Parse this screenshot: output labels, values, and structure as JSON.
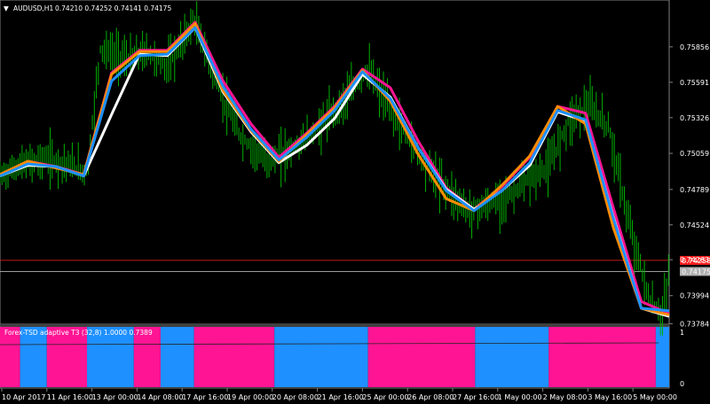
{
  "window_title": "AUDUSD,H1",
  "ohlc_text": "0.74210 0.74252 0.74141 0.74175",
  "main_chart": {
    "type": "line",
    "y_range": [
      0.7378,
      0.7618
    ],
    "y_ticks": [
      "0.75856",
      "0.75591",
      "0.75326",
      "0.75059",
      "0.74789",
      "0.74524",
      "0.74263",
      "0.73994",
      "0.73784"
    ],
    "y_tick_values": [
      0.75856,
      0.75591,
      0.75326,
      0.75059,
      0.74789,
      0.74524,
      0.74263,
      0.73994,
      0.73784
    ],
    "x_labels": [
      "10 Apr 2017",
      "11 Apr 16:00",
      "13 Apr 00:00",
      "14 Apr 08:00",
      "17 Apr 16:00",
      "19 Apr 00:00",
      "20 Apr 08:00",
      "21 Apr 16:00",
      "25 Apr 00:00",
      "26 Apr 08:00",
      "27 Apr 16:00",
      "1 May 00:00",
      "2 May 08:00",
      "3 May 16:00",
      "5 May 00:00"
    ],
    "horizontal_lines": [
      {
        "label": "0.74258",
        "value": 0.74258,
        "color": "#ff2020"
      },
      {
        "label": "0.74175",
        "value": 0.74175,
        "color": "#b0b0b0"
      }
    ],
    "colors": {
      "price": "#00b000",
      "white_ma": "#ffffff",
      "blue_ma": "#1e90ff",
      "orange_ma": "#ff8c00",
      "pink_ma": "#ff1493"
    },
    "x_index": [
      0,
      5,
      10,
      15,
      20,
      25,
      30,
      35,
      40,
      45,
      50,
      55,
      60,
      65,
      70,
      75,
      80,
      85,
      90,
      95,
      100
    ],
    "price": [
      0.7489,
      0.7497,
      0.7502,
      0.7498,
      0.7491,
      0.7584,
      0.7576,
      0.7582,
      0.757,
      0.7605,
      0.755,
      0.7518,
      0.7499,
      0.751,
      0.7522,
      0.7543,
      0.7568,
      0.7541,
      0.751,
      0.7483,
      0.7463,
      0.7467,
      0.7474,
      0.7486,
      0.7496,
      0.7531,
      0.7542,
      0.7525,
      0.7453,
      0.7397,
      0.7384,
      0.7418
    ],
    "price_x": [
      0,
      3,
      7,
      10,
      13,
      15,
      19,
      22,
      25,
      29,
      33,
      36,
      40,
      44,
      47,
      51,
      55,
      58,
      62,
      66,
      70,
      73,
      76,
      79,
      82,
      85,
      88,
      91,
      94,
      97,
      99,
      100
    ],
    "series": [
      {
        "name": "white",
        "values": [
          0.7489,
          0.7497,
          0.7496,
          0.7489,
          0.7535,
          0.758,
          0.7579,
          0.76,
          0.7552,
          0.7522,
          0.7499,
          0.7512,
          0.7532,
          0.7565,
          0.7548,
          0.751,
          0.7479,
          0.7464,
          0.7478,
          0.7497,
          0.7537,
          0.753,
          0.7458,
          0.739,
          0.7384
        ]
      },
      {
        "name": "blue",
        "values": [
          0.7489,
          0.7498,
          0.7496,
          0.7489,
          0.756,
          0.7579,
          0.758,
          0.76,
          0.7556,
          0.7524,
          0.7501,
          0.7518,
          0.7538,
          0.7567,
          0.7547,
          0.751,
          0.7478,
          0.7463,
          0.7478,
          0.7499,
          0.7538,
          0.7531,
          0.7457,
          0.739,
          0.7388
        ]
      },
      {
        "name": "orange",
        "values": [
          0.749,
          0.75,
          0.7495,
          0.749,
          0.7565,
          0.7582,
          0.7582,
          0.7603,
          0.7553,
          0.7523,
          0.75,
          0.752,
          0.754,
          0.7568,
          0.7545,
          0.7505,
          0.7472,
          0.7463,
          0.7482,
          0.7504,
          0.7541,
          0.7528,
          0.745,
          0.739,
          0.7385
        ]
      },
      {
        "name": "pink",
        "values": [
          0.749,
          0.75,
          0.7496,
          0.749,
          0.7566,
          0.7583,
          0.7583,
          0.7604,
          0.756,
          0.7528,
          0.7503,
          0.7521,
          0.7541,
          0.7569,
          0.7555,
          0.7515,
          0.748,
          0.7464,
          0.7481,
          0.7503,
          0.7541,
          0.7536,
          0.7465,
          0.7395,
          0.7386
        ]
      }
    ]
  },
  "indicator": {
    "label": "Forex-TSD adaptive T3 (32,8) 1.0000 0.7389",
    "y_ticks": [
      "1",
      "0"
    ],
    "blocks": [
      {
        "color": "#ff1493",
        "from": 0,
        "to": 3
      },
      {
        "color": "#1e90ff",
        "from": 3,
        "to": 7
      },
      {
        "color": "#ff1493",
        "from": 7,
        "to": 13
      },
      {
        "color": "#1e90ff",
        "from": 13,
        "to": 20
      },
      {
        "color": "#ff1493",
        "from": 20,
        "to": 24
      },
      {
        "color": "#1e90ff",
        "from": 24,
        "to": 29
      },
      {
        "color": "#ff1493",
        "from": 29,
        "to": 41
      },
      {
        "color": "#1e90ff",
        "from": 41,
        "to": 55
      },
      {
        "color": "#ff1493",
        "from": 55,
        "to": 71
      },
      {
        "color": "#1e90ff",
        "from": 71,
        "to": 82
      },
      {
        "color": "#ff1493",
        "from": 82,
        "to": 98
      },
      {
        "color": "#1e90ff",
        "from": 98,
        "to": 100
      }
    ]
  }
}
